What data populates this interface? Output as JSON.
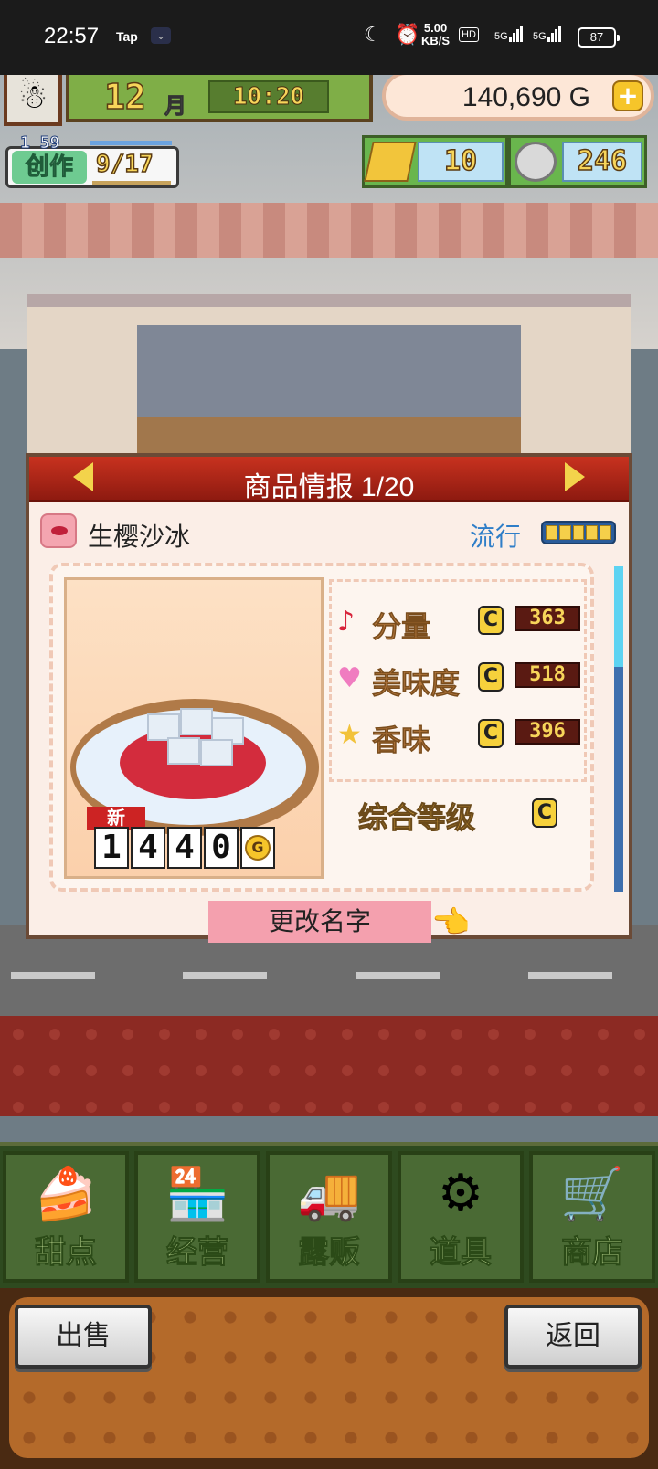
{
  "statusbar": {
    "time": "22:57",
    "app_tag": "Tap",
    "speed_value": "5.00",
    "speed_unit": "KB/S",
    "hd": "HD",
    "sig1": "5G",
    "sig2": "5G",
    "battery": "87"
  },
  "hud": {
    "month_num": "12",
    "month_label": "月",
    "clock": "10:20",
    "gold": "140,690 G",
    "craft_time": "1 59",
    "craft_label": "创作",
    "craft_count": "9/17",
    "bars": "10",
    "coins": "246"
  },
  "dialog": {
    "title": "商品情报 1/20",
    "product_name": "生樱沙冰",
    "trend_label": "流行",
    "trend_level": 5,
    "new_badge": "新",
    "price_digits": [
      "1",
      "4",
      "4",
      "0"
    ],
    "price_unit": "G",
    "stats": [
      {
        "icon": "music-note-icon",
        "glyph": "♪",
        "color": "#d8233b",
        "label": "分量",
        "grade": "C",
        "value": "363"
      },
      {
        "icon": "heart-icon",
        "glyph": "♥",
        "color": "#f07cc0",
        "label": "美味度",
        "grade": "C",
        "value": "518"
      },
      {
        "icon": "star-icon",
        "glyph": "★",
        "color": "#f2c23a",
        "label": "香味",
        "grade": "C",
        "value": "396"
      }
    ],
    "overall_label": "综合等级",
    "overall_grade": "C",
    "rename": "更改名字"
  },
  "menu": [
    {
      "name": "menu-dessert",
      "icon": "cake-icon",
      "glyph": "🍰",
      "label": "甜点"
    },
    {
      "name": "menu-management",
      "icon": "shop-icon",
      "glyph": "🏪",
      "label": "经营"
    },
    {
      "name": "menu-stall",
      "icon": "truck-icon",
      "glyph": "🚚",
      "label": "露贩"
    },
    {
      "name": "menu-items",
      "icon": "gear-bag-icon",
      "glyph": "⚙",
      "label": "道具"
    },
    {
      "name": "menu-store",
      "icon": "cart-icon",
      "glyph": "🛒",
      "label": "商店"
    }
  ],
  "footer": {
    "sell": "出售",
    "back": "返回"
  }
}
